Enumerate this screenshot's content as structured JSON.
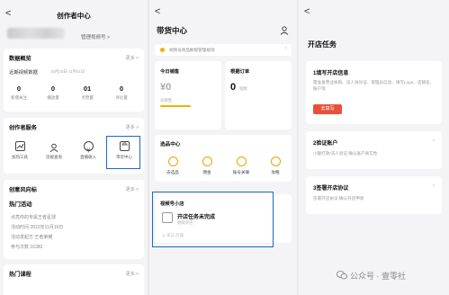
{
  "panel1": {
    "back": "<",
    "title": "创作者中心",
    "manage_link": "管理视频号 >",
    "overview": {
      "title": "数据概览",
      "more": "更多 >",
      "recent": "近期视频数据",
      "range": "10月20日-11月01日"
    },
    "stats": [
      {
        "value": "0",
        "label": "新增关注"
      },
      {
        "value": "0",
        "label": "播放量"
      },
      {
        "value": "01",
        "label": "点赞量"
      },
      {
        "value": "0",
        "label": "评论量"
      }
    ],
    "services": {
      "title": "创作者服务",
      "more": "更多 >",
      "items": [
        {
          "label": "加热工具",
          "icon": "chart-icon"
        },
        {
          "label": "违规查询",
          "icon": "user-search-icon"
        },
        {
          "label": "直播收入",
          "icon": "income-icon"
        },
        {
          "label": "带货中心",
          "icon": "shop-icon"
        }
      ]
    },
    "inspire": {
      "title": "创意风向标",
      "more": "更多 >",
      "activity_title": "热门活动",
      "rows": [
        "点亮你的专属王者星球",
        "活动时间  2022年11月16日",
        "活动发起方  王者荣耀",
        "参与次数  16383"
      ]
    },
    "courses": {
      "title": "热门课程",
      "more": "更多 >"
    }
  },
  "panel2": {
    "back": "<",
    "title": "带货中心",
    "notice": "视频号商品橱窗管理规则",
    "today_sales": {
      "label": "今日销售",
      "value": "¥0",
      "sub": "总销售"
    },
    "orders": {
      "label": "根据订单",
      "value": "0",
      "unit": "笔数"
    },
    "tools": {
      "title": "选品中心",
      "items": [
        {
          "label": "去选品",
          "icon": "select-icon"
        },
        {
          "label": "佣金",
          "icon": "commission-icon"
        },
        {
          "label": "账号关联",
          "icon": "link-icon"
        },
        {
          "label": "攻略",
          "icon": "guide-icon"
        }
      ]
    },
    "shop": {
      "title": "视频号小店",
      "task": "开店任务未完成",
      "task_sub": "继续开店",
      "footer": "◎ 未认  店铺"
    }
  },
  "panel3": {
    "back": "<",
    "title": "开店任务",
    "tasks": [
      {
        "title": "1填写开店信息",
        "desc": "需准备营业执照、法人身份证、管理员信息、填写Logo、店铺名、账户等",
        "button": "去填写"
      },
      {
        "title": "2验证账户",
        "desc": "小额打款/法人验证 确认账户真实性",
        "button": ""
      },
      {
        "title": "3签署开店协议",
        "desc": "签署开店协议 确认开店申请",
        "button": ""
      }
    ]
  },
  "watermark": "公众号 · 壹零社",
  "colors": {
    "accent": "#1967d2",
    "red": "#e8503a",
    "yellow": "#f0b000"
  }
}
